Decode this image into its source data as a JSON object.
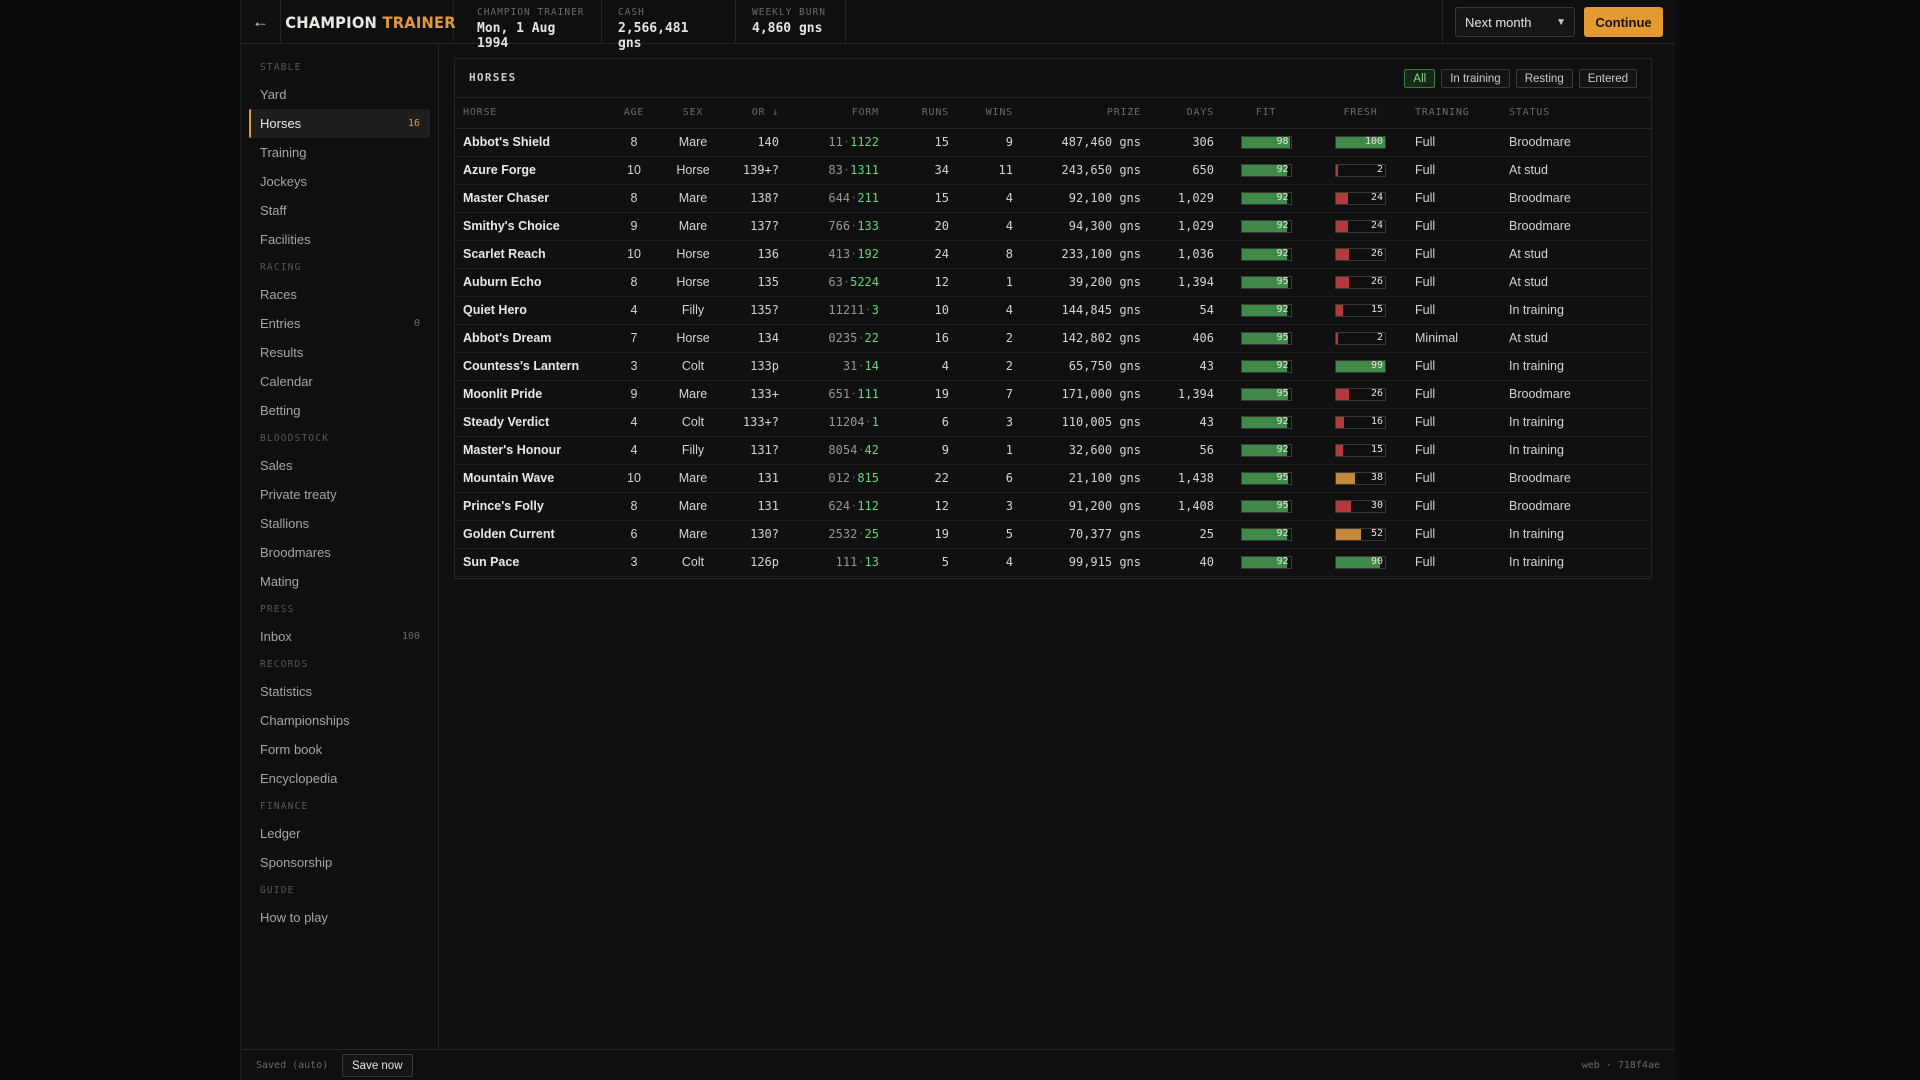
{
  "header": {
    "back_icon": "arrow-left-icon",
    "brand_part1": "CHAMPION",
    "brand_part2": "TRAINER",
    "stats": [
      {
        "label": "CHAMPION TRAINER",
        "value": "Mon, 1 Aug 1994"
      },
      {
        "label": "CASH",
        "value": "2,566,481 gns"
      },
      {
        "label": "WEEKLY BURN",
        "value": "4,860 gns"
      }
    ],
    "advance_select": "Next month",
    "continue_label": "Continue"
  },
  "sidebar": {
    "sections": [
      {
        "title": "STABLE",
        "items": [
          {
            "label": "Yard",
            "count": ""
          },
          {
            "label": "Horses",
            "count": "16",
            "active": true
          },
          {
            "label": "Training",
            "count": ""
          },
          {
            "label": "Jockeys",
            "count": ""
          },
          {
            "label": "Staff",
            "count": ""
          },
          {
            "label": "Facilities",
            "count": ""
          }
        ]
      },
      {
        "title": "RACING",
        "items": [
          {
            "label": "Races",
            "count": ""
          },
          {
            "label": "Entries",
            "count": "0"
          },
          {
            "label": "Results",
            "count": ""
          },
          {
            "label": "Calendar",
            "count": ""
          },
          {
            "label": "Betting",
            "count": ""
          }
        ]
      },
      {
        "title": "BLOODSTOCK",
        "items": [
          {
            "label": "Sales",
            "count": ""
          },
          {
            "label": "Private treaty",
            "count": ""
          },
          {
            "label": "Stallions",
            "count": ""
          },
          {
            "label": "Broodmares",
            "count": ""
          },
          {
            "label": "Mating",
            "count": ""
          }
        ]
      },
      {
        "title": "PRESS",
        "items": [
          {
            "label": "Inbox",
            "count": "100"
          }
        ]
      },
      {
        "title": "RECORDS",
        "items": [
          {
            "label": "Statistics",
            "count": ""
          },
          {
            "label": "Championships",
            "count": ""
          },
          {
            "label": "Form book",
            "count": ""
          },
          {
            "label": "Encyclopedia",
            "count": ""
          }
        ]
      },
      {
        "title": "FINANCE",
        "items": [
          {
            "label": "Ledger",
            "count": ""
          },
          {
            "label": "Sponsorship",
            "count": ""
          }
        ]
      },
      {
        "title": "GUIDE",
        "items": [
          {
            "label": "How to play",
            "count": ""
          }
        ]
      }
    ]
  },
  "panel": {
    "title": "HORSES",
    "filters": [
      {
        "label": "All",
        "active": true
      },
      {
        "label": "In training",
        "active": false
      },
      {
        "label": "Resting",
        "active": false
      },
      {
        "label": "Entered",
        "active": false
      }
    ],
    "columns": [
      "HORSE",
      "AGE",
      "SEX",
      "OR ↓",
      "FORM",
      "RUNS",
      "WINS",
      "PRIZE",
      "DAYS",
      "FIT",
      "FRESH",
      "TRAINING",
      "STATUS"
    ],
    "rows": [
      {
        "horse": "Abbot's Shield",
        "age": "8",
        "sex": "Mare",
        "or": "140",
        "form_a": "11",
        "form_b": "1122",
        "runs": "15",
        "wins": "9",
        "prize": "487,460 gns",
        "days": "306",
        "fit": 98,
        "fresh": 100,
        "training": "Full",
        "status": "Broodmare"
      },
      {
        "horse": "Azure Forge",
        "age": "10",
        "sex": "Horse",
        "or": "139+?",
        "form_a": "83",
        "form_b": "1311",
        "runs": "34",
        "wins": "11",
        "prize": "243,650 gns",
        "days": "650",
        "fit": 92,
        "fresh": 2,
        "training": "Full",
        "status": "At stud"
      },
      {
        "horse": "Master Chaser",
        "age": "8",
        "sex": "Mare",
        "or": "138?",
        "form_a": "644",
        "form_b": "211",
        "runs": "15",
        "wins": "4",
        "prize": "92,100 gns",
        "days": "1,029",
        "fit": 92,
        "fresh": 24,
        "training": "Full",
        "status": "Broodmare"
      },
      {
        "horse": "Smithy's Choice",
        "age": "9",
        "sex": "Mare",
        "or": "137?",
        "form_a": "766",
        "form_b": "133",
        "runs": "20",
        "wins": "4",
        "prize": "94,300 gns",
        "days": "1,029",
        "fit": 92,
        "fresh": 24,
        "training": "Full",
        "status": "Broodmare"
      },
      {
        "horse": "Scarlet Reach",
        "age": "10",
        "sex": "Horse",
        "or": "136",
        "form_a": "413",
        "form_b": "192",
        "runs": "24",
        "wins": "8",
        "prize": "233,100 gns",
        "days": "1,036",
        "fit": 92,
        "fresh": 26,
        "training": "Full",
        "status": "At stud"
      },
      {
        "horse": "Auburn Echo",
        "age": "8",
        "sex": "Horse",
        "or": "135",
        "form_a": "63",
        "form_b": "5224",
        "runs": "12",
        "wins": "1",
        "prize": "39,200 gns",
        "days": "1,394",
        "fit": 95,
        "fresh": 26,
        "training": "Full",
        "status": "At stud"
      },
      {
        "horse": "Quiet Hero",
        "age": "4",
        "sex": "Filly",
        "or": "135?",
        "form_a": "11211",
        "form_b": "3",
        "runs": "10",
        "wins": "4",
        "prize": "144,845 gns",
        "days": "54",
        "fit": 92,
        "fresh": 15,
        "training": "Full",
        "status": "In training"
      },
      {
        "horse": "Abbot's Dream",
        "age": "7",
        "sex": "Horse",
        "or": "134",
        "form_a": "0235",
        "form_b": "22",
        "runs": "16",
        "wins": "2",
        "prize": "142,802 gns",
        "days": "406",
        "fit": 95,
        "fresh": 2,
        "training": "Minimal",
        "status": "At stud"
      },
      {
        "horse": "Countess's Lantern",
        "age": "3",
        "sex": "Colt",
        "or": "133p",
        "form_a": "31",
        "form_b": "14",
        "runs": "4",
        "wins": "2",
        "prize": "65,750 gns",
        "days": "43",
        "fit": 92,
        "fresh": 99,
        "training": "Full",
        "status": "In training"
      },
      {
        "horse": "Moonlit Pride",
        "age": "9",
        "sex": "Mare",
        "or": "133+",
        "form_a": "651",
        "form_b": "111",
        "runs": "19",
        "wins": "7",
        "prize": "171,000 gns",
        "days": "1,394",
        "fit": 95,
        "fresh": 26,
        "training": "Full",
        "status": "Broodmare"
      },
      {
        "horse": "Steady Verdict",
        "age": "4",
        "sex": "Colt",
        "or": "133+?",
        "form_a": "11204",
        "form_b": "1",
        "runs": "6",
        "wins": "3",
        "prize": "110,005 gns",
        "days": "43",
        "fit": 92,
        "fresh": 16,
        "training": "Full",
        "status": "In training"
      },
      {
        "horse": "Master's Honour",
        "age": "4",
        "sex": "Filly",
        "or": "131?",
        "form_a": "8054",
        "form_b": "42",
        "runs": "9",
        "wins": "1",
        "prize": "32,600 gns",
        "days": "56",
        "fit": 92,
        "fresh": 15,
        "training": "Full",
        "status": "In training"
      },
      {
        "horse": "Mountain Wave",
        "age": "10",
        "sex": "Mare",
        "or": "131",
        "form_a": "012",
        "form_b": "815",
        "runs": "22",
        "wins": "6",
        "prize": "21,100 gns",
        "days": "1,438",
        "fit": 95,
        "fresh": 38,
        "training": "Full",
        "status": "Broodmare"
      },
      {
        "horse": "Prince's Folly",
        "age": "8",
        "sex": "Mare",
        "or": "131",
        "form_a": "624",
        "form_b": "112",
        "runs": "12",
        "wins": "3",
        "prize": "91,200 gns",
        "days": "1,408",
        "fit": 95,
        "fresh": 30,
        "training": "Full",
        "status": "Broodmare"
      },
      {
        "horse": "Golden Current",
        "age": "6",
        "sex": "Mare",
        "or": "130?",
        "form_a": "2532",
        "form_b": "25",
        "runs": "19",
        "wins": "5",
        "prize": "70,377 gns",
        "days": "25",
        "fit": 92,
        "fresh": 52,
        "training": "Full",
        "status": "In training"
      },
      {
        "horse": "Sun Pace",
        "age": "3",
        "sex": "Colt",
        "or": "126p",
        "form_a": "111",
        "form_b": "13",
        "runs": "5",
        "wins": "4",
        "prize": "99,915 gns",
        "days": "40",
        "fit": 92,
        "fresh": 90,
        "training": "Full",
        "status": "In training"
      }
    ]
  },
  "footer": {
    "saved_text": "Saved (auto)",
    "save_button": "Save now",
    "build": "web · 718f4ae"
  },
  "colors": {
    "accent": "#e09a3c",
    "fit_bar": "#3f8a48",
    "fresh_high": "#3f8a48",
    "fresh_mid": "#c28a3a",
    "fresh_low": "#b23a3a",
    "form_recent": "#6bd27a"
  }
}
